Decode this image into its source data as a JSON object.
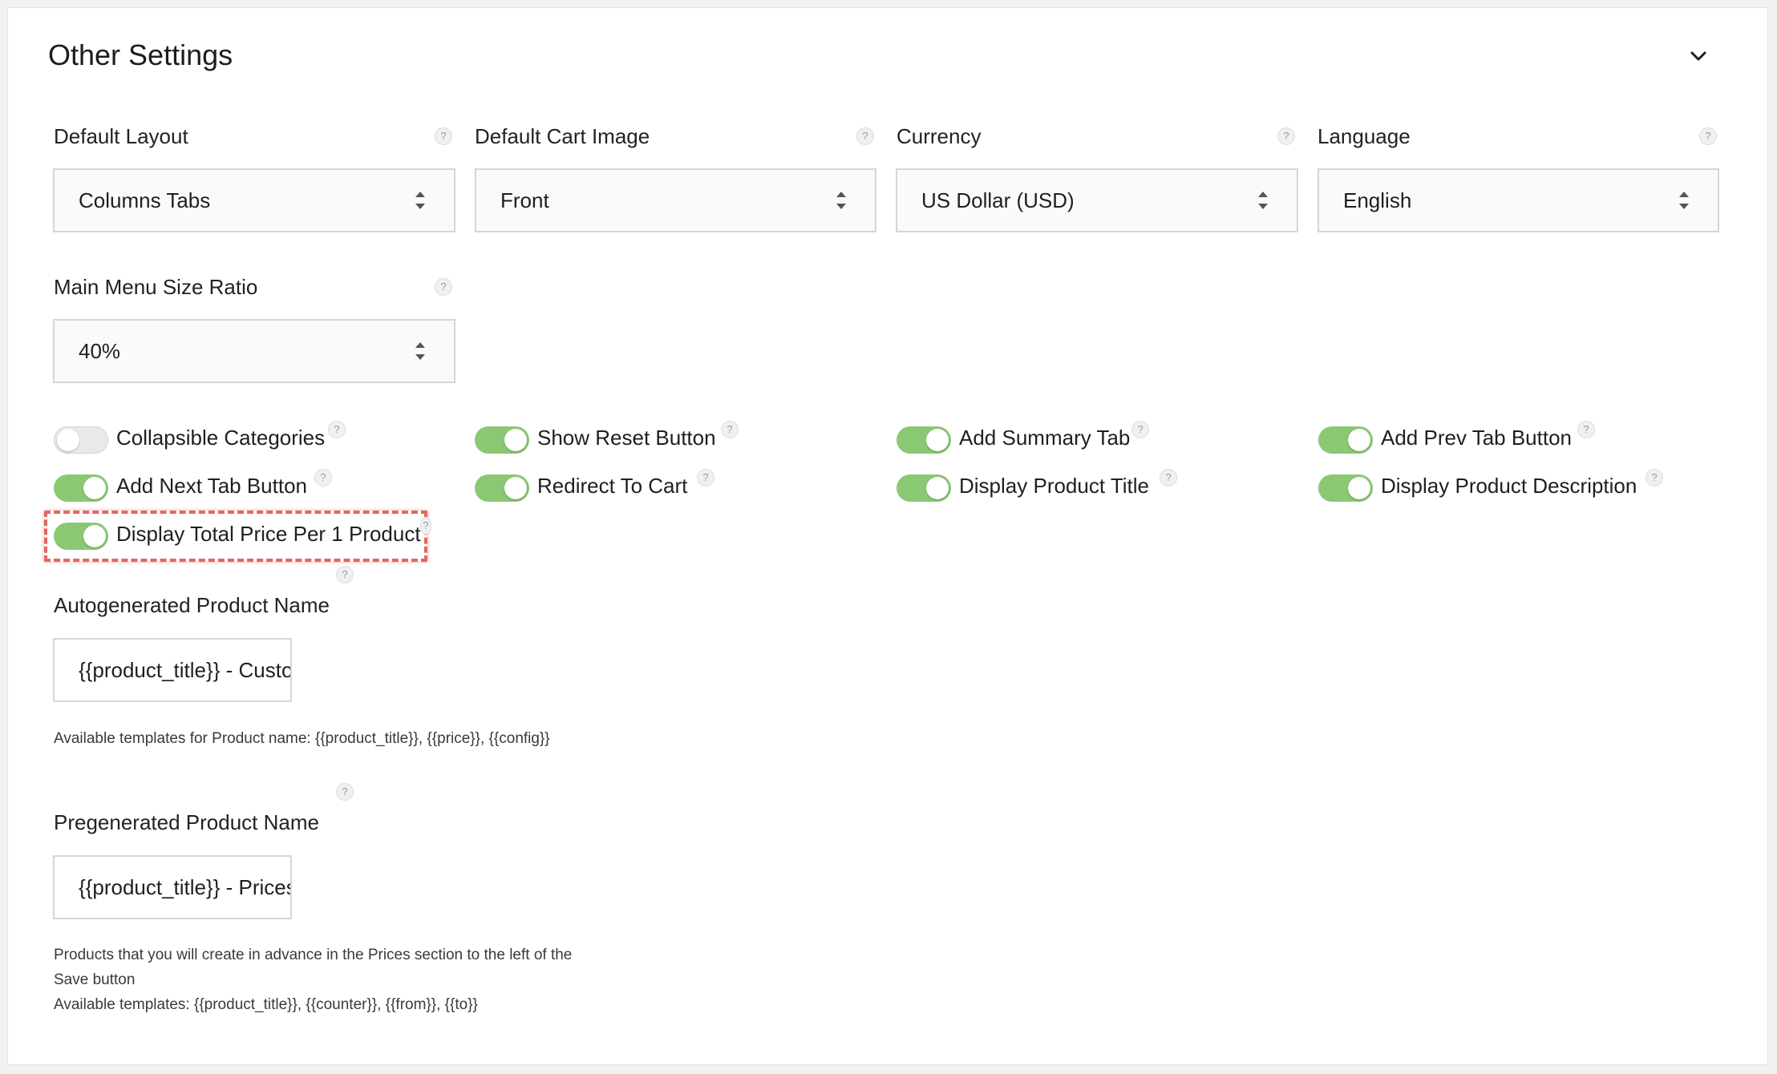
{
  "section": {
    "title": "Other Settings",
    "collapse_icon": "chevron-down-icon"
  },
  "selects": {
    "default_layout": {
      "label": "Default Layout",
      "value": "Columns Tabs"
    },
    "default_cart_image": {
      "label": "Default Cart Image",
      "value": "Front"
    },
    "currency": {
      "label": "Currency",
      "value": "US Dollar (USD)"
    },
    "language": {
      "label": "Language",
      "value": "English"
    },
    "main_menu_size_ratio": {
      "label": "Main Menu Size Ratio",
      "value": "40%"
    }
  },
  "help_glyph": "?",
  "toggles": {
    "collapsible_categories": {
      "label": "Collapsible Categories",
      "on": false
    },
    "show_reset_button": {
      "label": "Show Reset Button",
      "on": true
    },
    "add_summary_tab": {
      "label": "Add Summary Tab",
      "on": true
    },
    "add_prev_tab_button": {
      "label": "Add Prev Tab Button",
      "on": true
    },
    "add_next_tab_button": {
      "label": "Add Next Tab Button",
      "on": true
    },
    "redirect_to_cart": {
      "label": "Redirect To Cart",
      "on": true
    },
    "display_product_title": {
      "label": "Display Product Title",
      "on": true
    },
    "display_product_description": {
      "label": "Display Product Description",
      "on": true
    },
    "display_total_price_per_1_product": {
      "label": "Display Total Price Per 1 Product",
      "on": true
    }
  },
  "autogenerated_name": {
    "label": "Autogenerated Product Name",
    "value": "{{product_title}} - Custon",
    "hint": "Available templates for Product name: {{product_title}}, {{price}}, {{config}}"
  },
  "pregenerated_name": {
    "label": "Pregenerated Product Name",
    "value": "{{product_title}} - Prices f",
    "hint_line1": "Products that you will create in advance in the Prices section to the left of the",
    "hint_line2": "Save button",
    "hint_line3": "Available templates: {{product_title}}, {{counter}}, {{from}}, {{to}}"
  },
  "colors": {
    "toggle_on": "#8bc873",
    "toggle_off": "#e9e9e9",
    "highlight": "#e2685c"
  }
}
